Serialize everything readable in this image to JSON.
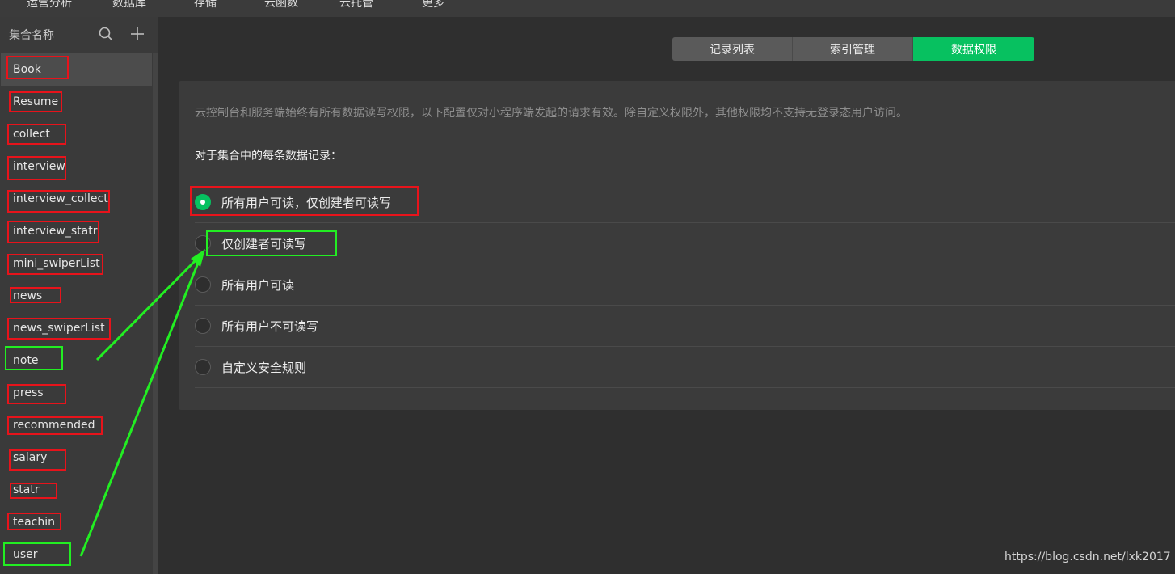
{
  "topnav": {
    "items": [
      "运营分析",
      "数据库",
      "存储",
      "云函数",
      "云托管",
      "更多"
    ]
  },
  "sidebar": {
    "title": "集合名称",
    "collections": [
      "Book",
      "Resume",
      "collect",
      "interview",
      "interview_collect",
      "interview_statr",
      "mini_swiperList",
      "news",
      "news_swiperList",
      "note",
      "press",
      "recommended",
      "salary",
      "statr",
      "teachin",
      "user"
    ],
    "selected": "Book"
  },
  "tabs": {
    "items": [
      "记录列表",
      "索引管理",
      "数据权限"
    ],
    "active": "数据权限"
  },
  "permissions": {
    "notice": "云控制台和服务端始终有所有数据读写权限，以下配置仅对小程序端发起的请求有效。除自定义权限外，其他权限均不支持无登录态用户访问。",
    "subheading": "对于集合中的每条数据记录：",
    "options": [
      "所有用户可读，仅创建者可读写",
      "仅创建者可读写",
      "所有用户可读",
      "所有用户不可读写",
      "自定义安全规则"
    ],
    "selected": "所有用户可读，仅创建者可读写"
  },
  "colors": {
    "accent": "#07c160",
    "annotation_red": "#e8131b",
    "annotation_green": "#22ee22"
  },
  "watermark": "https://blog.csdn.net/lxk2017"
}
